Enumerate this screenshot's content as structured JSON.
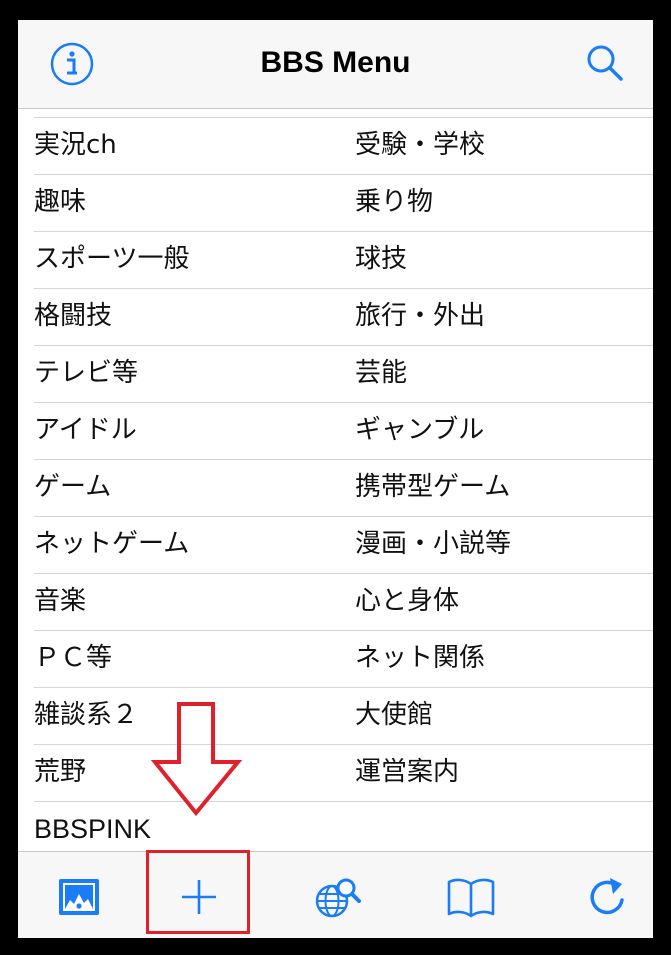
{
  "header": {
    "title": "BBS Menu",
    "info_icon": "info-icon",
    "search_icon": "search-icon"
  },
  "categories": [
    {
      "left": "実況ch",
      "right": "受験・学校"
    },
    {
      "left": "趣味",
      "right": "乗り物"
    },
    {
      "left": "スポーツ一般",
      "right": "球技"
    },
    {
      "left": "格闘技",
      "right": "旅行・外出"
    },
    {
      "left": "テレビ等",
      "right": "芸能"
    },
    {
      "left": "アイドル",
      "right": "ギャンブル"
    },
    {
      "left": "ゲーム",
      "right": "携帯型ゲーム"
    },
    {
      "left": "ネットゲーム",
      "right": "漫画・小説等"
    },
    {
      "left": "音楽",
      "right": "心と身体"
    },
    {
      "left": "ＰＣ等",
      "right": "ネット関係"
    },
    {
      "left": "雑談系２",
      "right": "大使館"
    },
    {
      "left": "荒野",
      "right": "運営案内"
    },
    {
      "left": "BBSPINK",
      "right": ""
    }
  ],
  "toolbar": {
    "icons": [
      "photo-icon",
      "plus-icon",
      "globe-search-icon",
      "book-icon",
      "refresh-icon"
    ]
  },
  "colors": {
    "accent": "#1a7cf6",
    "annotation": "#e0202a",
    "background": "#ffffff"
  }
}
